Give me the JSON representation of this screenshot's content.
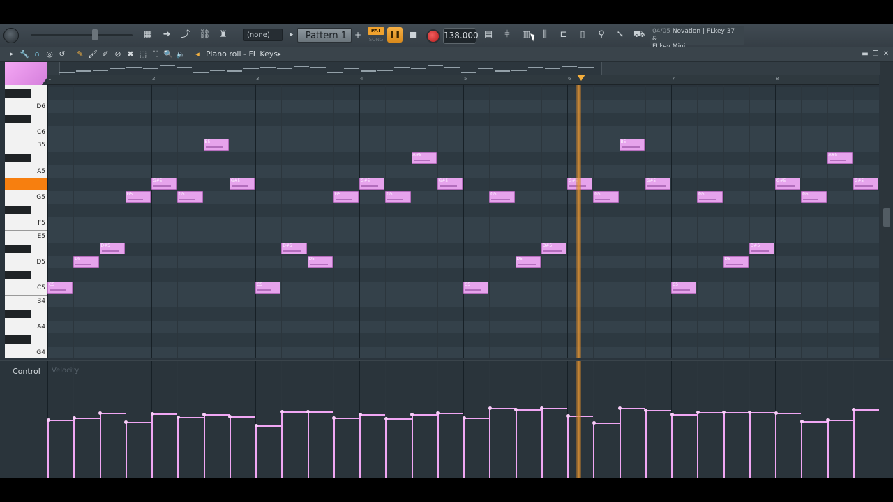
{
  "toolbar": {
    "none_label": "(none)",
    "pattern_label": "Pattern 1",
    "pat_label": "PAT",
    "song_label": "SONG",
    "tempo": "138.000",
    "hint_num": "04/05",
    "hint_text": "Novation | FLkey 37 &",
    "hint_text2": "FLkey Mini"
  },
  "piano_roll": {
    "title": "Piano roll - FL Keys",
    "bars": [
      "1",
      "2",
      "3",
      "4",
      "5",
      "6",
      "7",
      "8",
      "9"
    ]
  },
  "keyboard": {
    "labels": [
      "D6",
      "C6",
      "B5",
      "A5",
      "G5",
      "F5",
      "E5",
      "D5",
      "C5",
      "B4",
      "A4",
      "G4"
    ]
  },
  "control": {
    "label": "Control",
    "sub": "Velocity"
  },
  "notes": [
    {
      "label": "C5",
      "step": 0,
      "pitch": "C5"
    },
    {
      "label": "D5",
      "step": 1,
      "pitch": "D5"
    },
    {
      "label": "D#5",
      "step": 2,
      "pitch": "D#5"
    },
    {
      "label": "G5",
      "step": 3,
      "pitch": "G5"
    },
    {
      "label": "G#5",
      "step": 4,
      "pitch": "G#5"
    },
    {
      "label": "G5",
      "step": 5,
      "pitch": "G5"
    },
    {
      "label": "B5",
      "step": 6,
      "pitch": "B5"
    },
    {
      "label": "G#5",
      "step": 7,
      "pitch": "G#5"
    },
    {
      "label": "C5",
      "step": 8,
      "pitch": "C5"
    },
    {
      "label": "D#5",
      "step": 9,
      "pitch": "D#5"
    },
    {
      "label": "D5",
      "step": 10,
      "pitch": "D5"
    },
    {
      "label": "G5",
      "step": 11,
      "pitch": "G5"
    },
    {
      "label": "G#5",
      "step": 12,
      "pitch": "G#5"
    },
    {
      "label": "G5",
      "step": 13,
      "pitch": "G5"
    },
    {
      "label": "A#5",
      "step": 14,
      "pitch": "A#5"
    },
    {
      "label": "G#5",
      "step": 15,
      "pitch": "G#5"
    },
    {
      "label": "C5",
      "step": 16,
      "pitch": "C5"
    },
    {
      "label": "G5",
      "step": 17,
      "pitch": "G5"
    },
    {
      "label": "D5",
      "step": 18,
      "pitch": "D5"
    },
    {
      "label": "D#5",
      "step": 19,
      "pitch": "D#5"
    },
    {
      "label": "G#5",
      "step": 20,
      "pitch": "G#5"
    },
    {
      "label": "G5",
      "step": 21,
      "pitch": "G5"
    },
    {
      "label": "B5",
      "step": 22,
      "pitch": "B5"
    },
    {
      "label": "G#5",
      "step": 23,
      "pitch": "G#5"
    },
    {
      "label": "C5",
      "step": 24,
      "pitch": "C5"
    },
    {
      "label": "G5",
      "step": 25,
      "pitch": "G5"
    },
    {
      "label": "D5",
      "step": 26,
      "pitch": "D5"
    },
    {
      "label": "D#5",
      "step": 27,
      "pitch": "D#5"
    },
    {
      "label": "G#5",
      "step": 28,
      "pitch": "G#5"
    },
    {
      "label": "G5",
      "step": 29,
      "pitch": "G5"
    },
    {
      "label": "A#5",
      "step": 30,
      "pitch": "A#5"
    },
    {
      "label": "G#5",
      "step": 31,
      "pitch": "G#5"
    }
  ],
  "velocities": [
    0.72,
    0.74,
    0.8,
    0.69,
    0.79,
    0.75,
    0.78,
    0.76,
    0.65,
    0.82,
    0.82,
    0.74,
    0.78,
    0.73,
    0.78,
    0.8,
    0.74,
    0.86,
    0.84,
    0.86,
    0.77,
    0.68,
    0.86,
    0.83,
    0.78,
    0.81,
    0.81,
    0.81,
    0.8,
    0.7,
    0.72,
    0.84
  ]
}
